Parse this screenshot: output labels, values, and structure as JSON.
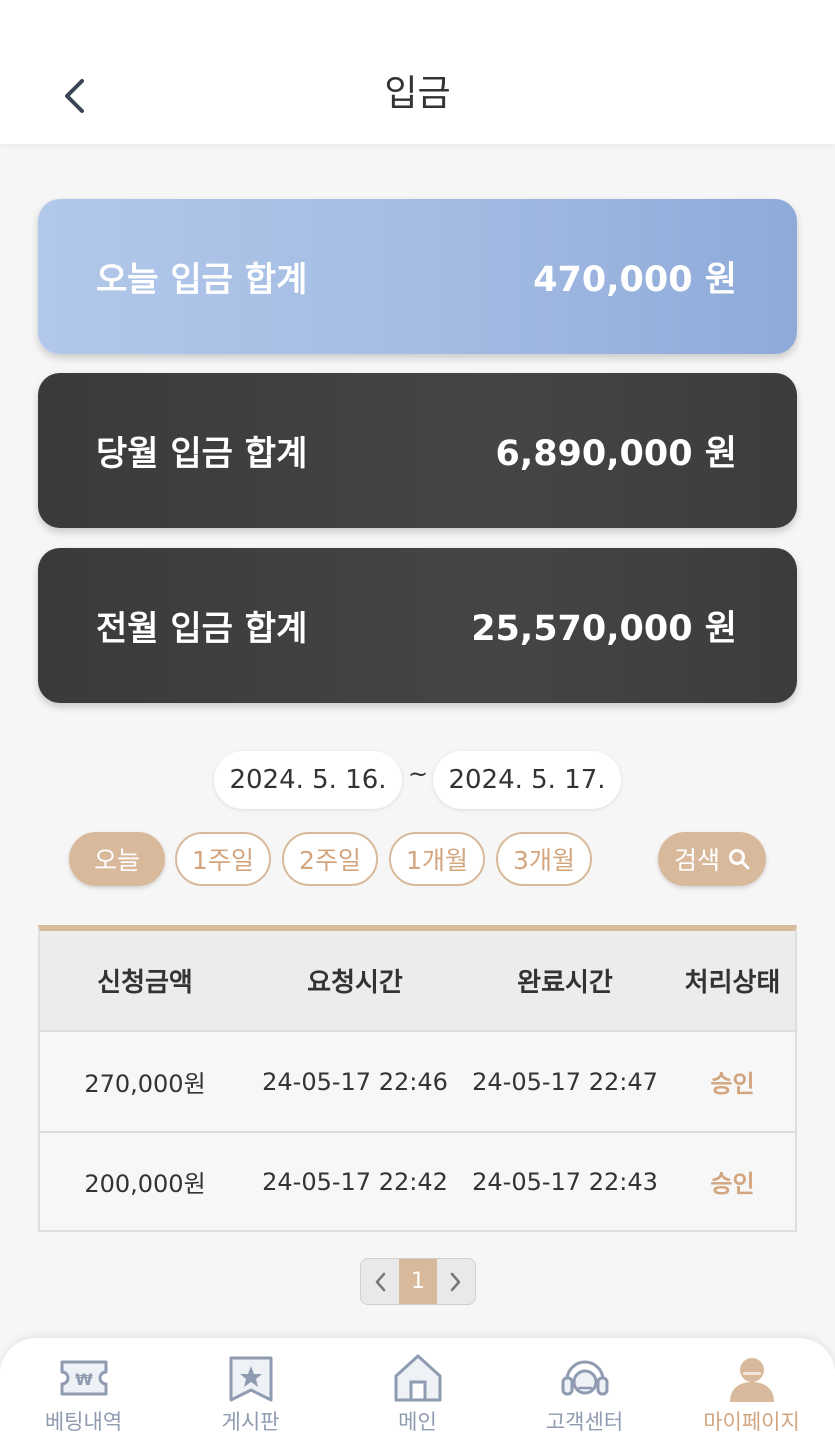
{
  "header": {
    "title": "입금"
  },
  "summary": {
    "today": {
      "label": "오늘 입금 합계",
      "amount": "470,000 원"
    },
    "month": {
      "label": "당월 입금 합계",
      "amount": "6,890,000 원"
    },
    "prev_month": {
      "label": "전월 입금 합계",
      "amount": "25,570,000 원"
    }
  },
  "date_range": {
    "start": "2024. 5. 16.",
    "separator": "~",
    "end": "2024. 5. 17."
  },
  "filters": [
    "오늘",
    "1주일",
    "2주일",
    "1개월",
    "3개월"
  ],
  "active_filter": "오늘",
  "search": {
    "label": "검색",
    "icon": "search-icon"
  },
  "table": {
    "headers": [
      "신청금액",
      "요청시간",
      "완료시간",
      "처리상태"
    ],
    "rows": [
      [
        "270,000원",
        "24-05-17 22:46",
        "24-05-17 22:47",
        "승인"
      ],
      [
        "200,000원",
        "24-05-17 22:42",
        "24-05-17 22:43",
        "승인"
      ]
    ]
  },
  "pagination": {
    "current": "1"
  },
  "bottom_nav": [
    {
      "label": "베팅내역",
      "icon": "betting-ticket-icon"
    },
    {
      "label": "게시판",
      "icon": "board-star-icon"
    },
    {
      "label": "메인",
      "icon": "home-icon"
    },
    {
      "label": "고객센터",
      "icon": "headset-icon"
    },
    {
      "label": "마이페이지",
      "icon": "user-icon",
      "active": true
    }
  ],
  "colors": {
    "accent": "#d9b99b",
    "accent_text": "#d3a57e",
    "today_card": "#a3bbe3",
    "dark_card": "#404040",
    "nav_icon": "#8f9bb0"
  }
}
